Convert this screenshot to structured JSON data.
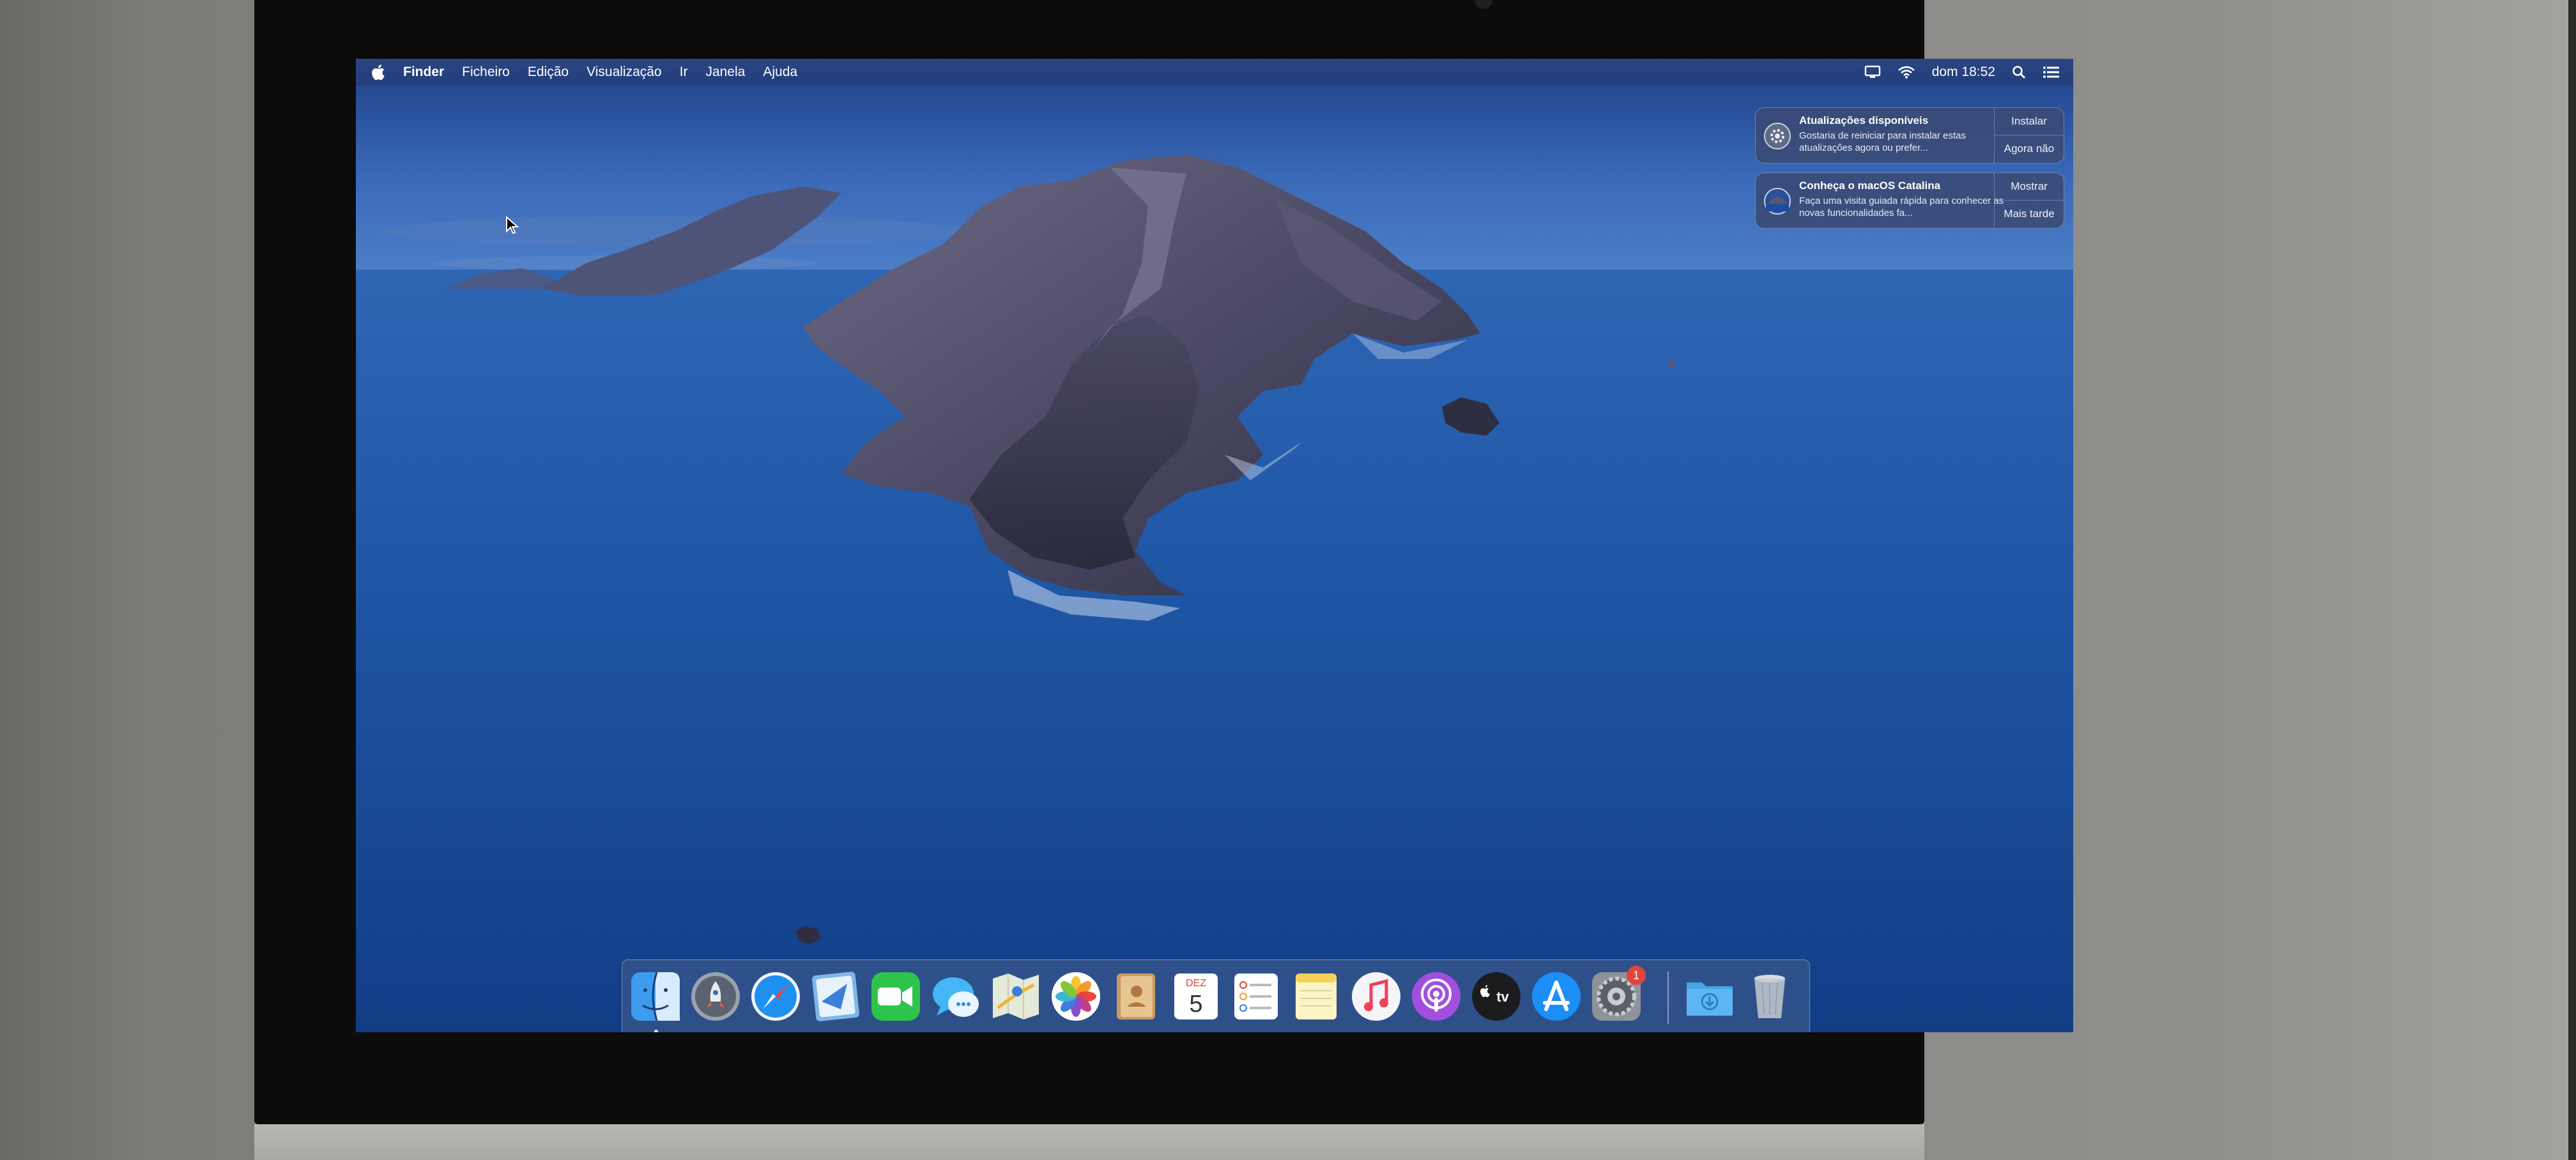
{
  "menubar": {
    "items": [
      "Finder",
      "Ficheiro",
      "Edição",
      "Visualização",
      "Ir",
      "Janela",
      "Ajuda"
    ],
    "clock": "dom 18:52",
    "status_icons": [
      "display-mirroring-icon",
      "wifi-icon",
      "spotlight-search-icon",
      "notification-center-icon"
    ]
  },
  "notifications": [
    {
      "title": "Atualizações disponíveis",
      "body": "Gostaria de reiniciar para instalar estas atualizações agora ou prefer...",
      "actions": [
        "Instalar",
        "Agora não"
      ],
      "icon": "software-update-gear-icon"
    },
    {
      "title": "Conheça o macOS Catalina",
      "body": "Faça uma visita guiada rápida para conhecer as novas funcionalidades fa...",
      "actions": [
        "Mostrar",
        "Mais tarde"
      ],
      "icon": "catalina-icon"
    }
  ],
  "dock": {
    "apps": [
      {
        "name": "Finder",
        "icon": "finder-icon",
        "running": true
      },
      {
        "name": "Launchpad",
        "icon": "launchpad-icon"
      },
      {
        "name": "Safari",
        "icon": "safari-icon"
      },
      {
        "name": "Mail",
        "icon": "mail-icon"
      },
      {
        "name": "FaceTime",
        "icon": "facetime-icon"
      },
      {
        "name": "Mensagens",
        "icon": "messages-icon"
      },
      {
        "name": "Mapas",
        "icon": "maps-icon"
      },
      {
        "name": "Fotografias",
        "icon": "photos-icon"
      },
      {
        "name": "Contactos",
        "icon": "contacts-icon"
      },
      {
        "name": "Calendário",
        "icon": "calendar-icon",
        "calendar_month": "DEZ",
        "calendar_day": "5"
      },
      {
        "name": "Lembretes",
        "icon": "reminders-icon"
      },
      {
        "name": "Notas",
        "icon": "notes-icon"
      },
      {
        "name": "Música",
        "icon": "music-icon"
      },
      {
        "name": "Podcasts",
        "icon": "podcasts-icon"
      },
      {
        "name": "TV",
        "icon": "apple-tv-icon",
        "label": "tv"
      },
      {
        "name": "App Store",
        "icon": "app-store-icon"
      },
      {
        "name": "Preferências do Sistema",
        "icon": "system-preferences-icon",
        "badge": "1"
      }
    ],
    "others": [
      {
        "name": "Downloads",
        "icon": "downloads-folder-icon"
      },
      {
        "name": "Lixo",
        "icon": "trash-icon"
      }
    ]
  },
  "colors": {
    "menubar": "#2c4682",
    "notification_bg": "#3a4a74",
    "badge": "#e0443a",
    "sea": "#1d4f9a"
  }
}
